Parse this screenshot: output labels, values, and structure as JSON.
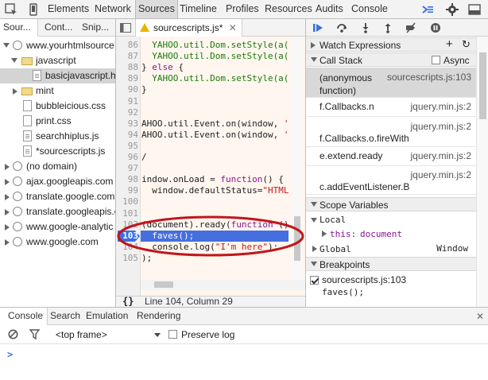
{
  "toolbar": {
    "tabs": [
      "Elements",
      "Network",
      "Sources",
      "Timeline",
      "Profiles",
      "Resources",
      "Audits",
      "Console"
    ],
    "selected": "Sources"
  },
  "navigator": {
    "tabs": [
      "Sour...",
      "Cont...",
      "Snip..."
    ],
    "tree": [
      {
        "label": "www.yourhtmlsource",
        "type": "domain",
        "expanded": true
      },
      {
        "label": "javascript",
        "type": "folder",
        "expanded": true
      },
      {
        "label": "basicjavascript.ht",
        "type": "file",
        "selected": true
      },
      {
        "label": "mint",
        "type": "folder",
        "expanded": false
      },
      {
        "label": "bubbleicious.css",
        "type": "file"
      },
      {
        "label": "print.css",
        "type": "file"
      },
      {
        "label": "searchhiplus.js",
        "type": "file"
      },
      {
        "label": "*sourcescripts.js",
        "type": "file"
      },
      {
        "label": "(no domain)",
        "type": "domain"
      },
      {
        "label": "ajax.googleapis.com",
        "type": "domain"
      },
      {
        "label": "translate.google.com",
        "type": "domain"
      },
      {
        "label": "translate.googleapis.c",
        "type": "domain"
      },
      {
        "label": "www.google-analytic",
        "type": "domain"
      },
      {
        "label": "www.google.com",
        "type": "domain"
      }
    ]
  },
  "editor": {
    "tab_label": "sourcescripts.js*",
    "lines": [
      {
        "n": "86",
        "text": "  YAHOO.util.Dom.setStyle(a("
      },
      {
        "n": "87",
        "text": "  YAHOO.util.Dom.setStyle(a("
      },
      {
        "n": "88",
        "text": "} else {"
      },
      {
        "n": "89",
        "text": "  YAHOO.util.Dom.setStyle(a("
      },
      {
        "n": "90",
        "text": "}"
      },
      {
        "n": "91",
        "text": ""
      },
      {
        "n": "92",
        "text": ""
      },
      {
        "n": "93",
        "text": "AHOO.util.Event.on(window, '"
      },
      {
        "n": "94",
        "text": "AHOO.util.Event.on(window, '"
      },
      {
        "n": "95",
        "text": ""
      },
      {
        "n": "96",
        "text": "/"
      },
      {
        "n": "97",
        "text": ""
      },
      {
        "n": "98",
        "text": "indow.onLoad = function() {"
      },
      {
        "n": "99",
        "text": "  window.defaultStatus=\"HTML"
      },
      {
        "n": "100",
        "text": ""
      },
      {
        "n": "101",
        "text": ""
      },
      {
        "n": "102",
        "text": "(document).ready(function ()"
      },
      {
        "n": "103",
        "text": "  faves();"
      },
      {
        "n": "104",
        "text": "  console.log(\"I'm here\");"
      },
      {
        "n": "105",
        "text": ");"
      }
    ],
    "status": "Line 104, Column 29",
    "format_label": "{}"
  },
  "debugger": {
    "watch_label": "Watch Expressions",
    "callstack_label": "Call Stack",
    "async_label": "Async",
    "frames": [
      {
        "fn": "(anonymous function)",
        "loc": "sourcescripts.js:103",
        "selected": true
      },
      {
        "fn": "f.Callbacks.n",
        "loc": "jquery.min.js:2"
      },
      {
        "fn": "f.Callbacks.o.fireWith",
        "loc": "jquery.min.js:2"
      },
      {
        "fn": "e.extend.ready",
        "loc": "jquery.min.js:2"
      },
      {
        "fn": "c.addEventListener.B",
        "loc": "jquery.min.js:2"
      }
    ],
    "scope_label": "Scope Variables",
    "local_label": "Local",
    "this_key": "this:",
    "this_val": "document",
    "global_label": "Global",
    "global_val": "Window",
    "breakpoints_label": "Breakpoints",
    "breakpoint_file": "sourcescripts.js:103",
    "breakpoint_code": "faves();"
  },
  "drawer": {
    "tabs": [
      "Console",
      "Search",
      "Emulation",
      "Rendering"
    ],
    "frame_select": "<top frame>",
    "preserve_log": "Preserve log",
    "prompt": ">"
  },
  "colors": {
    "accent": "#3b6ee3",
    "annotation": "#c0161c"
  }
}
